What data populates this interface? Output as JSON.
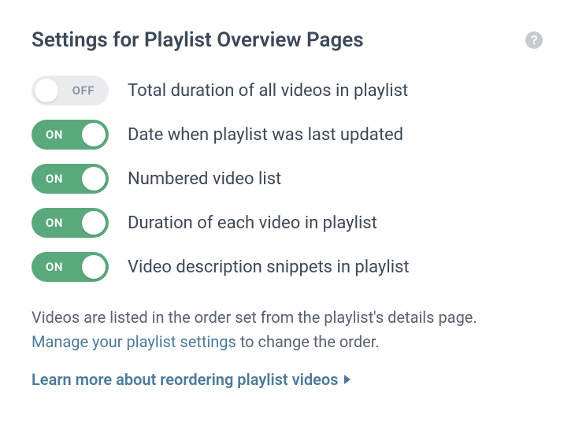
{
  "title": "Settings for Playlist Overview Pages",
  "help_icon_name": "help-icon",
  "toggles": [
    {
      "state": "off",
      "state_label": "OFF",
      "label": "Total duration of all videos in playlist"
    },
    {
      "state": "on",
      "state_label": "ON",
      "label": "Date when playlist was last updated"
    },
    {
      "state": "on",
      "state_label": "ON",
      "label": "Numbered video list"
    },
    {
      "state": "on",
      "state_label": "ON",
      "label": "Duration of each video in playlist"
    },
    {
      "state": "on",
      "state_label": "ON",
      "label": "Video description snippets in playlist"
    }
  ],
  "info": {
    "text_before": "Videos are listed in the order set from the playlist's details page. ",
    "link_text": "Manage your playlist settings",
    "text_after": " to change the order."
  },
  "learn_more": {
    "text": "Learn more about reordering playlist videos"
  }
}
